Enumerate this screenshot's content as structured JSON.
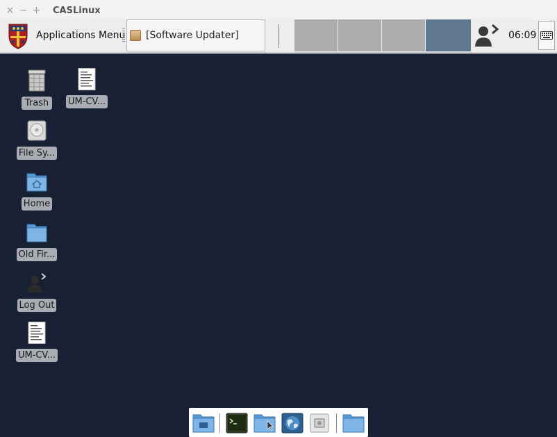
{
  "window": {
    "title": "CASLinux",
    "controls": {
      "close": "×",
      "minimize": "−",
      "maximize": "+"
    }
  },
  "panel": {
    "app_menu_label": "Applications Menu",
    "app_logo_icon": "crest-icon",
    "task_button_label": "[Software Updater]",
    "task_icon": "package-icon",
    "workspaces": [
      {
        "name": "workspace-1",
        "active": false
      },
      {
        "name": "workspace-2",
        "active": false
      },
      {
        "name": "workspace-3",
        "active": false
      },
      {
        "name": "workspace-4",
        "active": true
      }
    ],
    "user_icon": "user-switch-icon",
    "clock": "06:09",
    "keyboard_icon": "keyboard-icon",
    "colors": {
      "workspace": "#adadad",
      "workspace_active": "#5f7890"
    }
  },
  "desktop": {
    "background": "#172133",
    "icons": [
      {
        "label": "Trash",
        "icon": "trash-icon"
      },
      {
        "label": "UM-CV...",
        "icon": "document-icon"
      },
      {
        "label": "File Sy...",
        "icon": "drive-icon"
      },
      {
        "label": "Home",
        "icon": "home-folder-icon"
      },
      {
        "label": "Old Fir...",
        "icon": "folder-icon"
      },
      {
        "label": "Log Out",
        "icon": "logout-icon"
      },
      {
        "label": "UM-CV...",
        "icon": "document-icon"
      }
    ]
  },
  "dock": {
    "items": [
      {
        "name": "show-desktop",
        "icon": "show-desktop-icon"
      },
      {
        "name": "terminal",
        "icon": "terminal-icon"
      },
      {
        "name": "file-manager",
        "icon": "file-manager-icon"
      },
      {
        "name": "web-browser",
        "icon": "web-browser-icon"
      },
      {
        "name": "app-finder",
        "icon": "app-finder-icon"
      },
      {
        "name": "folder",
        "icon": "folder-icon"
      }
    ]
  }
}
